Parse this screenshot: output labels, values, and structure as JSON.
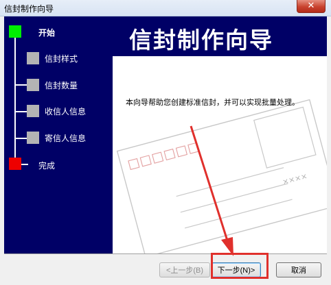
{
  "window": {
    "title": "信封制作向导",
    "close_label": "✕"
  },
  "banner": {
    "title": "信封制作向导"
  },
  "steps": [
    {
      "label": "开始",
      "color": "#00ee00",
      "bold": true
    },
    {
      "label": "信封样式",
      "color": "#b4b4b4",
      "bold": false
    },
    {
      "label": "信封数量",
      "color": "#b4b4b4",
      "bold": false
    },
    {
      "label": "收信人信息",
      "color": "#b4b4b4",
      "bold": false
    },
    {
      "label": "寄信人信息",
      "color": "#b4b4b4",
      "bold": false
    },
    {
      "label": "完成",
      "color": "#ee0000",
      "bold": false
    }
  ],
  "content": {
    "description": "本向导帮助您创建标准信封，并可以实现批量处理。",
    "envelope_marks": "××××"
  },
  "buttons": {
    "back": "<上一步(B)",
    "next": "下一步(N)>",
    "cancel": "取消"
  },
  "colors": {
    "sidebar_bg": "#000066",
    "annotation_red": "#e0302c"
  }
}
